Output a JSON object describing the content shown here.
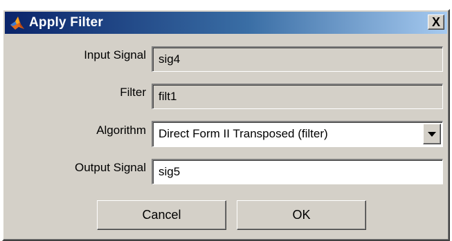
{
  "window": {
    "title": "Apply Filter",
    "close_label": "X"
  },
  "form": {
    "input_signal": {
      "label": "Input Signal",
      "value": "sig4"
    },
    "filter": {
      "label": "Filter",
      "value": "filt1"
    },
    "algorithm": {
      "label": "Algorithm",
      "selected": "Direct Form II Transposed (filter)"
    },
    "output_signal": {
      "label": "Output Signal",
      "value": "sig5"
    }
  },
  "buttons": {
    "cancel": "Cancel",
    "ok": "OK"
  },
  "icons": {
    "app": "matlab-logo-icon",
    "close": "close-icon",
    "dropdown": "chevron-down-icon"
  },
  "colors": {
    "title_gradient_start": "#0a246a",
    "title_gradient_end": "#a6caf0",
    "dialog_face": "#d4d0c8"
  }
}
